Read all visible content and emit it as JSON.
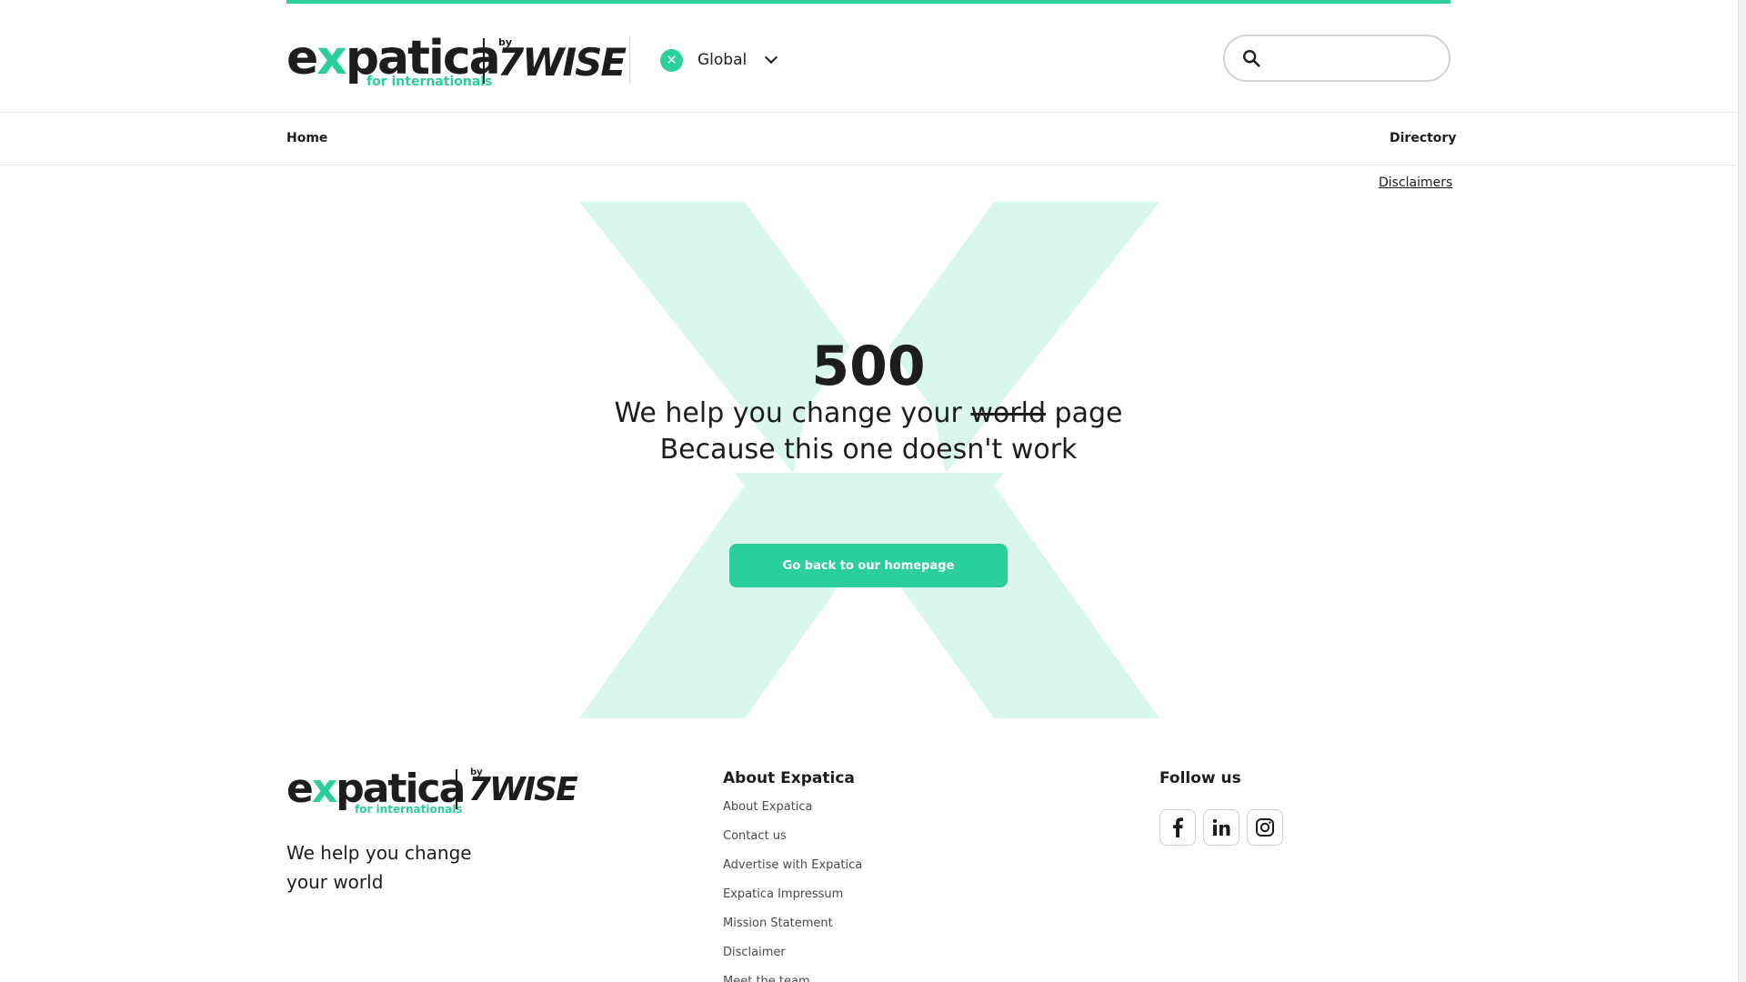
{
  "brand": {
    "word_left": "e",
    "word_x": "x",
    "word_right": "patica",
    "sub": "for internationals",
    "by": "by",
    "wise": "7WISE",
    "accent_color": "#2bcf9b"
  },
  "header": {
    "region_flag": "✕",
    "region_label": "Global",
    "search_placeholder": ""
  },
  "nav": {
    "home": "Home",
    "directory": "Directory"
  },
  "disclaimers_link": "Disclaimers",
  "error": {
    "code": "500",
    "line1_before": "We help you change your",
    "line1_strike": "world",
    "line1_after": "page",
    "line2": "Because this one doesn't work",
    "button": "Go back to our homepage"
  },
  "footer": {
    "tagline": "We help you change your world",
    "about_title": "About Expatica",
    "about_links": [
      "About Expatica",
      "Contact us",
      "Advertise with Expatica",
      "Expatica Impressum",
      "Mission Statement",
      "Disclaimer",
      "Meet the team"
    ],
    "follow_title": "Follow us",
    "social": [
      "facebook-icon",
      "linkedin-icon",
      "instagram-icon"
    ]
  }
}
